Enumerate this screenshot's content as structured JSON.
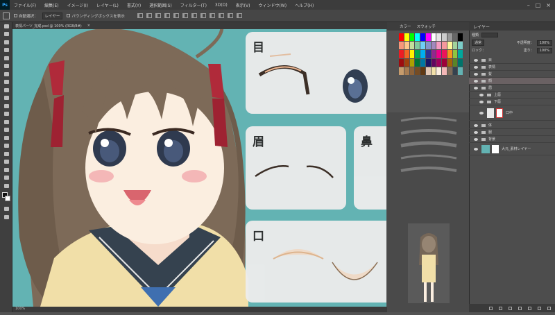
{
  "app": {
    "logo": "Ps",
    "menu": [
      "ファイル(F)",
      "編集(E)",
      "イメージ(I)",
      "レイヤー(L)",
      "書式(Y)",
      "選択範囲(S)",
      "フィルター(T)",
      "3D(D)",
      "表示(V)",
      "ウィンドウ(W)",
      "ヘルプ(H)"
    ],
    "window_controls": [
      "–",
      "□",
      "×"
    ]
  },
  "options": {
    "auto_select_label": "自動選択：",
    "auto_select_value": "レイヤー",
    "transform_label": "バウンディングボックスを表示"
  },
  "document": {
    "tab_title": "表情パーツ_完成.psd @ 100% (RGB/8#)",
    "status": "100%"
  },
  "cards": {
    "eyes": "目",
    "brows": "眉",
    "nose": "鼻",
    "mouth": "口"
  },
  "panels": {
    "color_tab": "カラー",
    "swatch_tab": "スウォッチ",
    "layers_tab": "レイヤー",
    "kind_label": "種類",
    "blend_mode": "通常",
    "opacity_label": "不透明度：",
    "opacity_value": "100%",
    "lock_label": "ロック：",
    "fill_label": "塗り：",
    "fill_value": "100%"
  },
  "layers": [
    {
      "name": "目",
      "type": "folder"
    },
    {
      "name": "表情",
      "type": "folder"
    },
    {
      "name": "髪",
      "type": "folder"
    },
    {
      "name": "顔",
      "type": "folder",
      "selected": true
    },
    {
      "name": "眉",
      "type": "folder"
    },
    {
      "name": "上唇",
      "type": "folder"
    },
    {
      "name": "下唇",
      "type": "folder"
    },
    {
      "name": "口中",
      "type": "layer"
    },
    {
      "name": "体",
      "type": "folder"
    },
    {
      "name": "服",
      "type": "folder"
    },
    {
      "name": "背景",
      "type": "folder"
    },
    {
      "name": "大元_素材レイヤー",
      "type": "layer"
    }
  ],
  "colors": {
    "canvas_bg": "#63b3b3",
    "card_bg": "#ececec",
    "ribbon": "#b02a3a",
    "hair": "#7d6a58",
    "skin": "#fbeee0",
    "uniform_collar": "#35424f",
    "cardigan": "#f1dfa8",
    "mouth_pink": "#ee8a8f"
  }
}
